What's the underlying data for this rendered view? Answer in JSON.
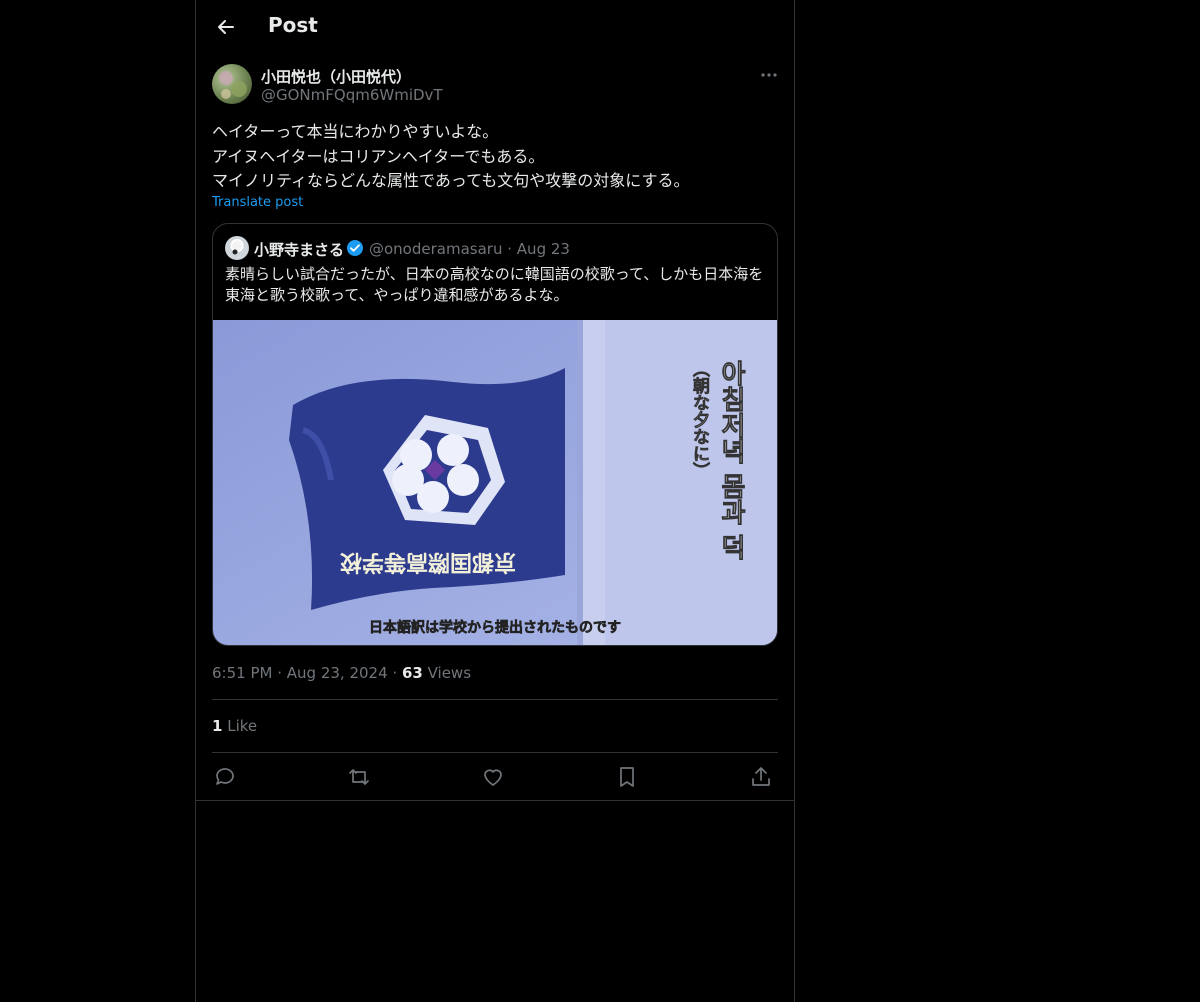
{
  "header": {
    "title": "Post"
  },
  "post": {
    "author_name": "小田悦也（小田悦代）",
    "author_handle": "@GONmFQqm6WmiDvT",
    "text_lines": [
      "ヘイターって本当にわかりやすいよな。",
      "アイヌヘイターはコリアンヘイターでもある。",
      "マイノリティならどんな属性であっても文句や攻撃の対象にする。"
    ],
    "translate_label": "Translate post",
    "time": "6:51 PM",
    "date": "Aug 23, 2024",
    "views_count": "63",
    "views_label": "Views",
    "likes_count": "1",
    "likes_label": "Like"
  },
  "quote": {
    "author_name": "小野寺まさる",
    "author_handle": "@onoderamasaru",
    "date": "Aug 23",
    "text_lines": [
      "素晴らしい試合だったが、日本の高校なのに韓国語の校歌って、しかも日本海を",
      "東海と歌う校歌って、やっぱり違和感があるよな。"
    ],
    "media": {
      "flag_text": "京都国際高等学校",
      "korean_lyric": "아침저녁 몸과 덕",
      "japanese_lyric": "（朝な夕なに）",
      "subtitle": "日本語訳は学校から提出されたものです"
    }
  },
  "colors": {
    "accent": "#1d9bf0",
    "text": "#e7e9ea",
    "muted": "#71767b",
    "border": "#2f3336"
  }
}
